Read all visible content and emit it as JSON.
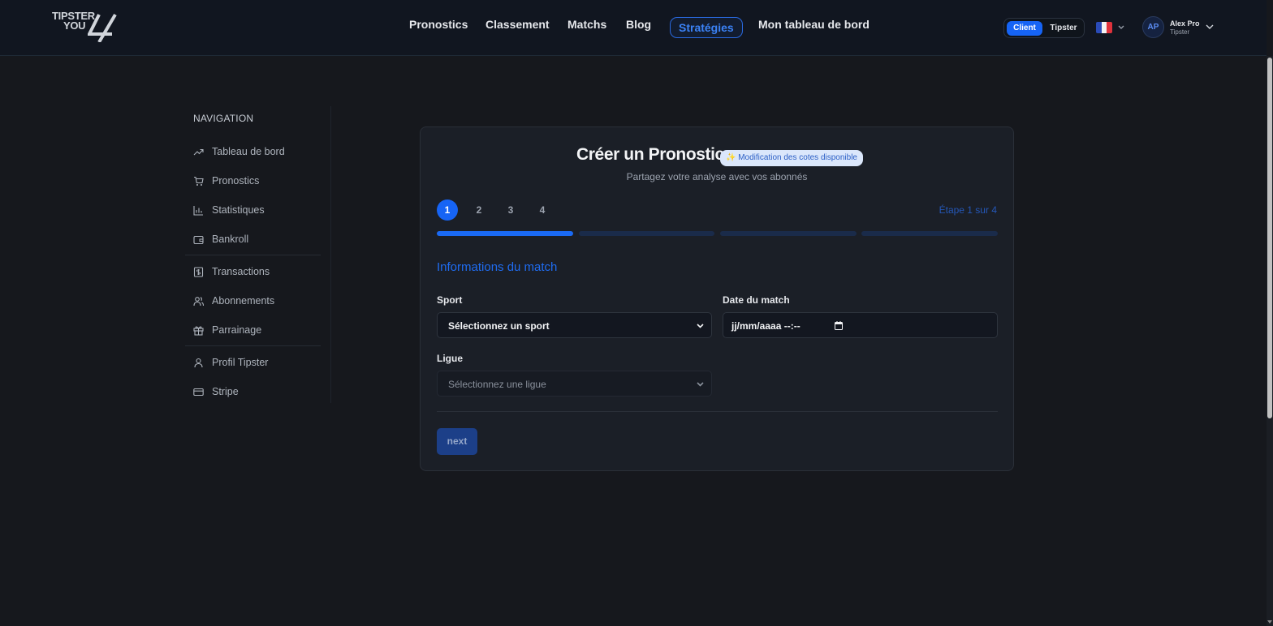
{
  "brand": {
    "logo_line1": "TIPSTER",
    "logo_line2": "YOU"
  },
  "header": {
    "nav": [
      {
        "label": "Pronostics"
      },
      {
        "label": "Classement"
      },
      {
        "label": "Matchs"
      },
      {
        "label": "Blog"
      },
      {
        "label": "Stratégies",
        "active": true
      },
      {
        "label": "Mon tableau de bord"
      }
    ],
    "role_toggle": {
      "client": "Client",
      "tipster": "Tipster",
      "selected": "Client"
    },
    "language": {
      "flag": "fr-flag-icon"
    },
    "user": {
      "initials": "AP",
      "name": "Alex Pro",
      "role": "Tipster"
    }
  },
  "sidebar": {
    "title": "NAVIGATION",
    "items": [
      {
        "label": "Tableau de bord",
        "icon": "trending-up-icon"
      },
      {
        "label": "Pronostics",
        "icon": "cart-icon"
      },
      {
        "label": "Statistiques",
        "icon": "bar-chart-icon"
      },
      {
        "label": "Bankroll",
        "icon": "wallet-icon"
      },
      {
        "label": "Transactions",
        "icon": "dollar-receipt-icon"
      },
      {
        "label": "Abonnements",
        "icon": "users-icon"
      },
      {
        "label": "Parrainage",
        "icon": "gift-icon"
      },
      {
        "label": "Profil Tipster",
        "icon": "user-icon"
      },
      {
        "label": "Stripe",
        "icon": "credit-card-icon"
      }
    ]
  },
  "form": {
    "title": "Créer un Pronostic",
    "badge": "✨ Modification des cotes disponible",
    "subtitle": "Partagez votre analyse avec vos abonnés",
    "steps": [
      "1",
      "2",
      "3",
      "4"
    ],
    "current_step": 1,
    "step_indicator": "Étape 1 sur 4",
    "progress_fraction": 0.25,
    "section_title": "Informations du match",
    "sport": {
      "label": "Sport",
      "value": "Sélectionnez un sport"
    },
    "date": {
      "label": "Date du match",
      "value": "jj/mm/aaaa --:--"
    },
    "league": {
      "label": "Ligue",
      "value": "Sélectionnez une ligue",
      "disabled": true
    },
    "next_button": "next"
  },
  "colors": {
    "accent": "#1664f5",
    "background": "#16181d",
    "header": "#111620",
    "card": "#1b1f27"
  }
}
